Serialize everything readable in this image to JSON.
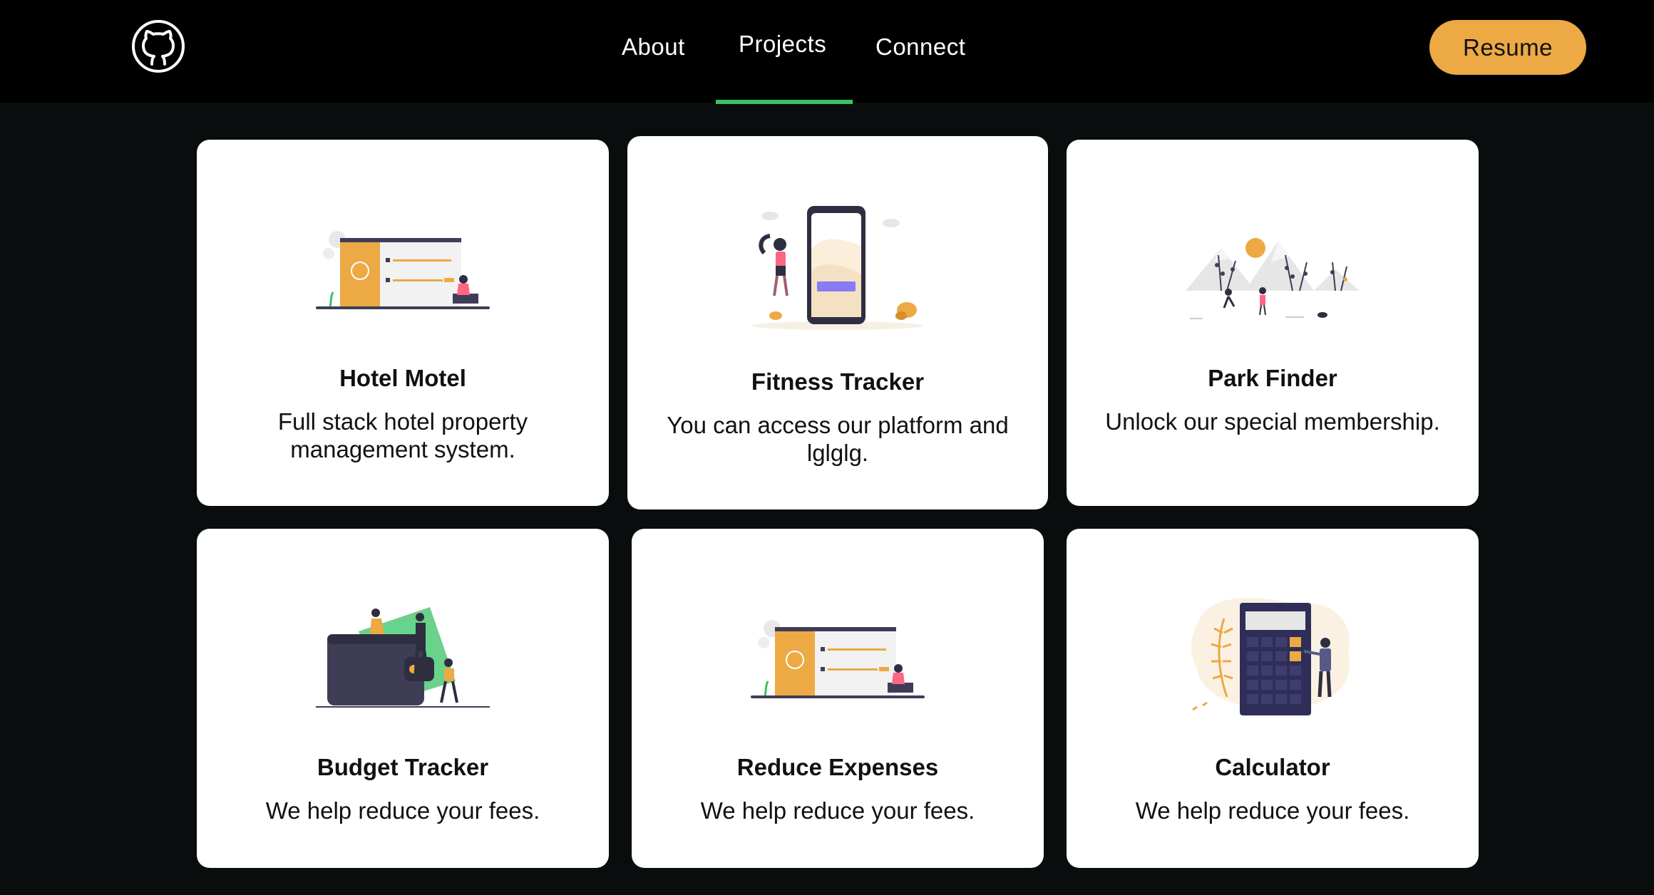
{
  "header": {
    "logo_icon": "github-icon",
    "nav": [
      {
        "label": "About"
      },
      {
        "label": "Projects"
      },
      {
        "label": "Connect"
      }
    ],
    "active_nav": "Projects",
    "resume_label": "Resume"
  },
  "colors": {
    "accent": "#eca944",
    "active_underline": "#3cc066",
    "background": "#000000",
    "card": "#ffffff"
  },
  "projects": [
    {
      "title": "Hotel Motel",
      "description": "Full stack hotel property management system.",
      "illustration": "booking-illustration"
    },
    {
      "title": "Fitness Tracker",
      "description": "You can access our platform and lglglg.",
      "illustration": "fitness-phone-illustration"
    },
    {
      "title": "Park Finder",
      "description": "Unlock our special membership.",
      "illustration": "park-mountains-illustration"
    },
    {
      "title": "Budget Tracker",
      "description": "We help reduce your fees.",
      "illustration": "wallet-money-illustration"
    },
    {
      "title": "Reduce Expenses",
      "description": "We help reduce your fees.",
      "illustration": "booking-illustration"
    },
    {
      "title": "Calculator",
      "description": "We help reduce your fees.",
      "illustration": "calculator-illustration"
    }
  ]
}
